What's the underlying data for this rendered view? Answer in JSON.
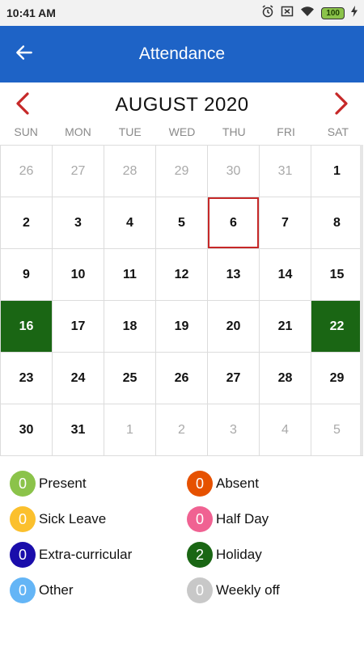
{
  "status_bar": {
    "time": "10:41 AM",
    "battery": "100",
    "icons": [
      "alarm-icon",
      "notification-off-icon",
      "wifi-icon",
      "battery-icon",
      "charging-icon"
    ]
  },
  "app_bar": {
    "title": "Attendance",
    "back_icon": "back-arrow-icon",
    "background": "#1e63c6"
  },
  "calendar": {
    "month_title": "AUGUST 2020",
    "prev_icon": "chevron-left-icon",
    "next_icon": "chevron-right-icon",
    "nav_color": "#c62828",
    "weekdays": [
      "SUN",
      "MON",
      "TUE",
      "WED",
      "THU",
      "FRI",
      "SAT"
    ],
    "selected_day": "6",
    "holiday_color": "#1a6614",
    "weeks": [
      [
        {
          "d": "26",
          "other": true
        },
        {
          "d": "27",
          "other": true
        },
        {
          "d": "28",
          "other": true
        },
        {
          "d": "29",
          "other": true
        },
        {
          "d": "30",
          "other": true
        },
        {
          "d": "31",
          "other": true
        },
        {
          "d": "1"
        }
      ],
      [
        {
          "d": "2"
        },
        {
          "d": "3"
        },
        {
          "d": "4"
        },
        {
          "d": "5"
        },
        {
          "d": "6",
          "today": true
        },
        {
          "d": "7"
        },
        {
          "d": "8"
        }
      ],
      [
        {
          "d": "9"
        },
        {
          "d": "10"
        },
        {
          "d": "11"
        },
        {
          "d": "12"
        },
        {
          "d": "13"
        },
        {
          "d": "14"
        },
        {
          "d": "15"
        }
      ],
      [
        {
          "d": "16",
          "holiday": true
        },
        {
          "d": "17"
        },
        {
          "d": "18"
        },
        {
          "d": "19"
        },
        {
          "d": "20"
        },
        {
          "d": "21"
        },
        {
          "d": "22",
          "holiday": true
        }
      ],
      [
        {
          "d": "23"
        },
        {
          "d": "24"
        },
        {
          "d": "25"
        },
        {
          "d": "26"
        },
        {
          "d": "27"
        },
        {
          "d": "28"
        },
        {
          "d": "29"
        }
      ],
      [
        {
          "d": "30"
        },
        {
          "d": "31"
        },
        {
          "d": "1",
          "other": true
        },
        {
          "d": "2",
          "other": true
        },
        {
          "d": "3",
          "other": true
        },
        {
          "d": "4",
          "other": true
        },
        {
          "d": "5",
          "other": true
        }
      ]
    ]
  },
  "legend": {
    "items": [
      {
        "count": "0",
        "label": "Present",
        "color": "#8bc34a"
      },
      {
        "count": "0",
        "label": "Absent",
        "color": "#e65100"
      },
      {
        "count": "0",
        "label": "Sick Leave",
        "color": "#fbc02d"
      },
      {
        "count": "0",
        "label": "Half Day",
        "color": "#f06292"
      },
      {
        "count": "0",
        "label": "Extra-curricular",
        "color": "#1a0dab"
      },
      {
        "count": "2",
        "label": "Holiday",
        "color": "#1a6614"
      },
      {
        "count": "0",
        "label": "Other",
        "color": "#64b5f6"
      },
      {
        "count": "0",
        "label": "Weekly off",
        "color": "#c8c8c8"
      }
    ]
  }
}
